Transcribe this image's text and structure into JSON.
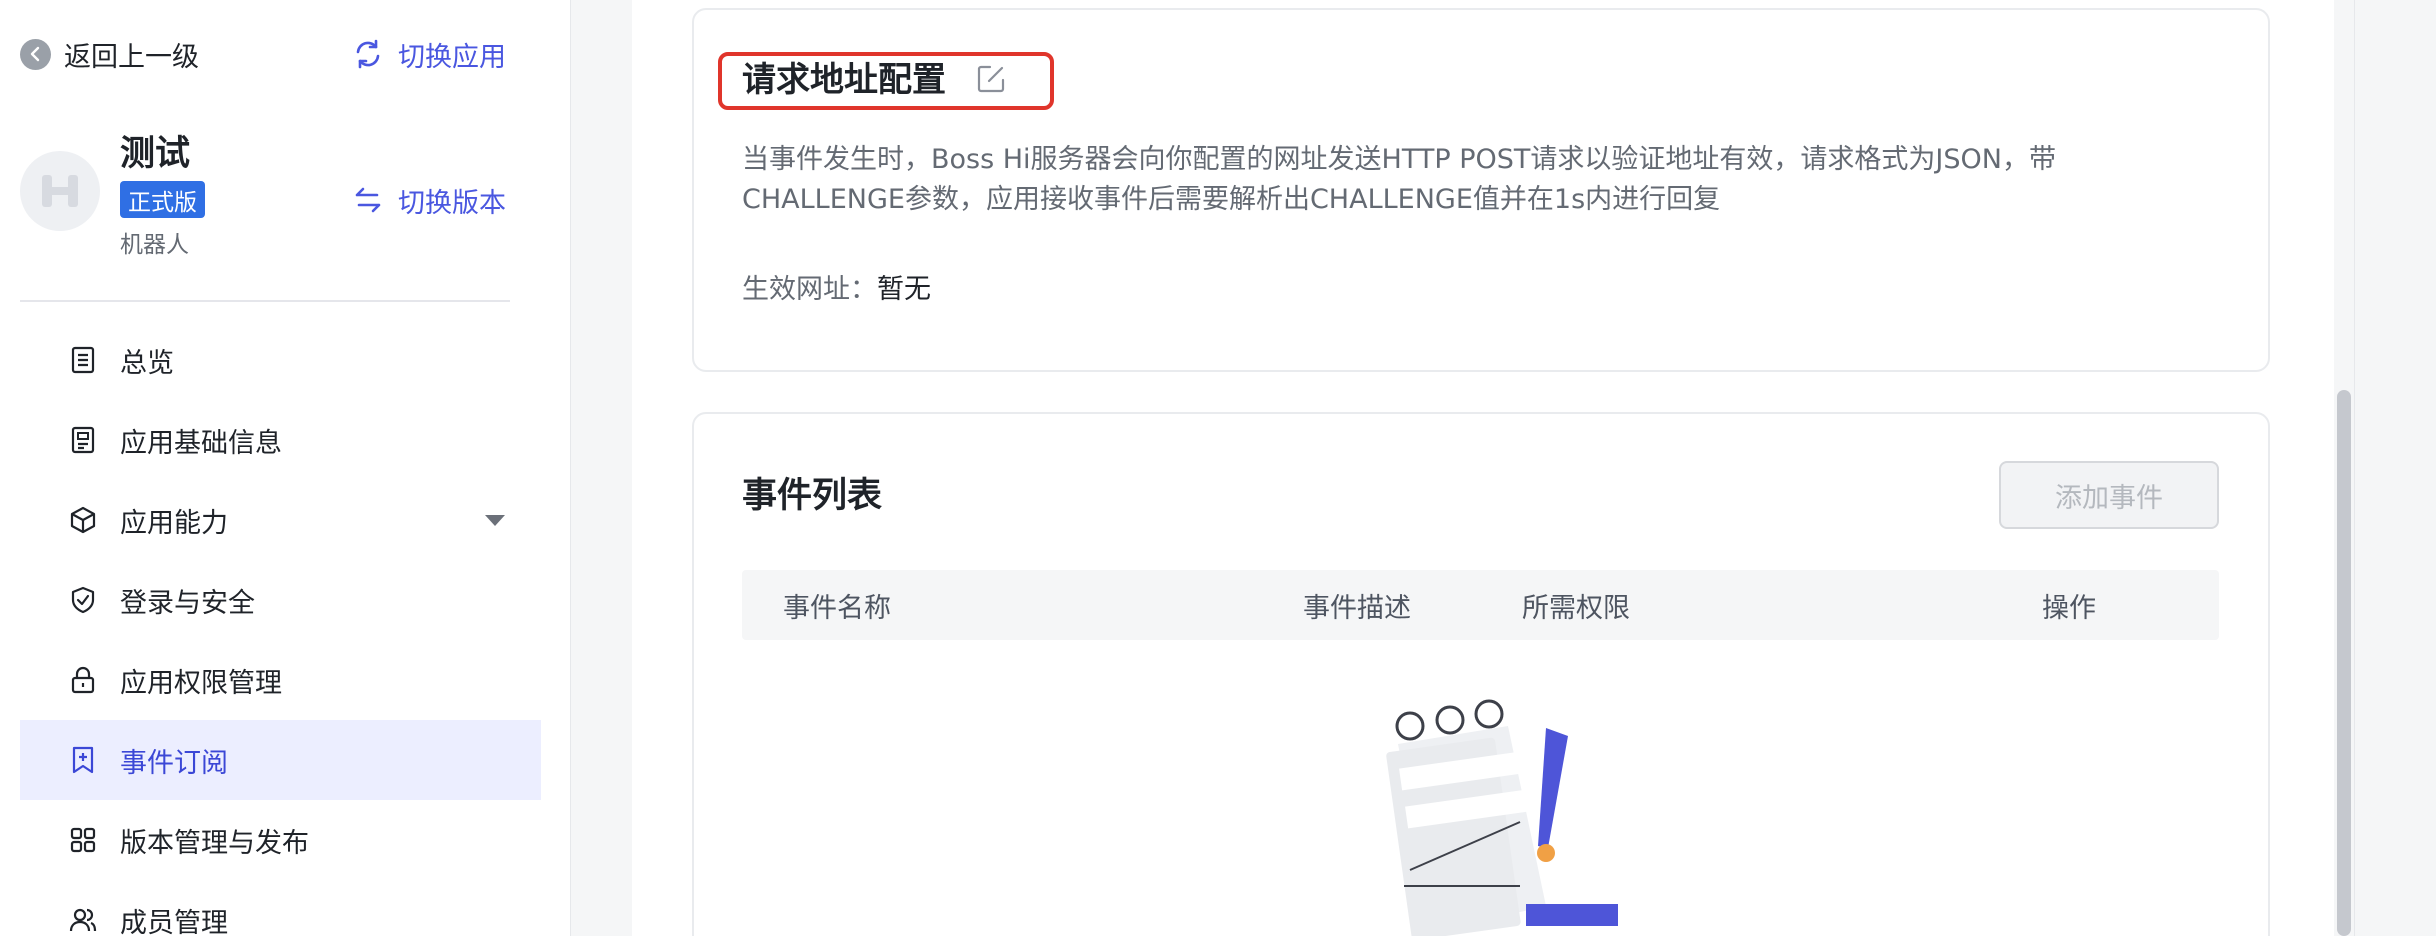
{
  "sidebar": {
    "back_label": "返回上一级",
    "switch_app_label": "切换应用",
    "app": {
      "name": "测试",
      "badge": "正式版",
      "type": "机器人",
      "switch_version_label": "切换版本"
    },
    "items": [
      {
        "label": "总览",
        "icon": "document-list-icon"
      },
      {
        "label": "应用基础信息",
        "icon": "info-card-icon"
      },
      {
        "label": "应用能力",
        "icon": "cube-icon",
        "expandable": true
      },
      {
        "label": "登录与安全",
        "icon": "shield-check-icon"
      },
      {
        "label": "应用权限管理",
        "icon": "lock-icon"
      },
      {
        "label": "事件订阅",
        "icon": "bookmark-plus-icon",
        "active": true
      },
      {
        "label": "版本管理与发布",
        "icon": "grid-icon"
      },
      {
        "label": "成员管理",
        "icon": "users-icon"
      }
    ]
  },
  "request_config": {
    "title": "请求地址配置",
    "description": "当事件发生时，Boss Hi服务器会向你配置的网址发送HTTP POST请求以验证地址有效，请求格式为JSON，带CHALLENGE参数，应用接收事件后需要解析出CHALLENGE值并在1s内进行回复",
    "effective_label": "生效网址：",
    "effective_value": "暂无"
  },
  "event_list": {
    "title": "事件列表",
    "add_button": "添加事件",
    "columns": [
      "事件名称",
      "事件描述",
      "所需权限",
      "操作"
    ]
  },
  "colors": {
    "accent": "#4a57e0",
    "active_bg": "#eceeff",
    "highlight_border": "#e0352b",
    "badge": "#2f6fe4"
  }
}
